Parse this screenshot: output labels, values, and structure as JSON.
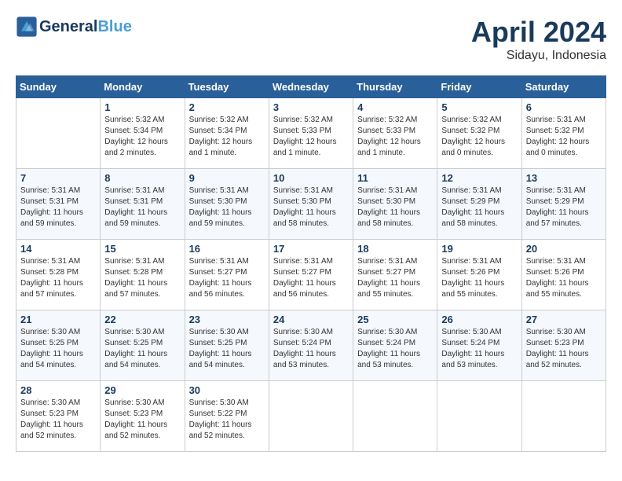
{
  "header": {
    "logo_line1": "General",
    "logo_line2": "Blue",
    "month": "April 2024",
    "location": "Sidayu, Indonesia"
  },
  "days_of_week": [
    "Sunday",
    "Monday",
    "Tuesday",
    "Wednesday",
    "Thursday",
    "Friday",
    "Saturday"
  ],
  "weeks": [
    [
      {
        "day": "",
        "info": ""
      },
      {
        "day": "1",
        "info": "Sunrise: 5:32 AM\nSunset: 5:34 PM\nDaylight: 12 hours\nand 2 minutes."
      },
      {
        "day": "2",
        "info": "Sunrise: 5:32 AM\nSunset: 5:34 PM\nDaylight: 12 hours\nand 1 minute."
      },
      {
        "day": "3",
        "info": "Sunrise: 5:32 AM\nSunset: 5:33 PM\nDaylight: 12 hours\nand 1 minute."
      },
      {
        "day": "4",
        "info": "Sunrise: 5:32 AM\nSunset: 5:33 PM\nDaylight: 12 hours\nand 1 minute."
      },
      {
        "day": "5",
        "info": "Sunrise: 5:32 AM\nSunset: 5:32 PM\nDaylight: 12 hours\nand 0 minutes."
      },
      {
        "day": "6",
        "info": "Sunrise: 5:31 AM\nSunset: 5:32 PM\nDaylight: 12 hours\nand 0 minutes."
      }
    ],
    [
      {
        "day": "7",
        "info": "Sunrise: 5:31 AM\nSunset: 5:31 PM\nDaylight: 11 hours\nand 59 minutes."
      },
      {
        "day": "8",
        "info": "Sunrise: 5:31 AM\nSunset: 5:31 PM\nDaylight: 11 hours\nand 59 minutes."
      },
      {
        "day": "9",
        "info": "Sunrise: 5:31 AM\nSunset: 5:30 PM\nDaylight: 11 hours\nand 59 minutes."
      },
      {
        "day": "10",
        "info": "Sunrise: 5:31 AM\nSunset: 5:30 PM\nDaylight: 11 hours\nand 58 minutes."
      },
      {
        "day": "11",
        "info": "Sunrise: 5:31 AM\nSunset: 5:30 PM\nDaylight: 11 hours\nand 58 minutes."
      },
      {
        "day": "12",
        "info": "Sunrise: 5:31 AM\nSunset: 5:29 PM\nDaylight: 11 hours\nand 58 minutes."
      },
      {
        "day": "13",
        "info": "Sunrise: 5:31 AM\nSunset: 5:29 PM\nDaylight: 11 hours\nand 57 minutes."
      }
    ],
    [
      {
        "day": "14",
        "info": "Sunrise: 5:31 AM\nSunset: 5:28 PM\nDaylight: 11 hours\nand 57 minutes."
      },
      {
        "day": "15",
        "info": "Sunrise: 5:31 AM\nSunset: 5:28 PM\nDaylight: 11 hours\nand 57 minutes."
      },
      {
        "day": "16",
        "info": "Sunrise: 5:31 AM\nSunset: 5:27 PM\nDaylight: 11 hours\nand 56 minutes."
      },
      {
        "day": "17",
        "info": "Sunrise: 5:31 AM\nSunset: 5:27 PM\nDaylight: 11 hours\nand 56 minutes."
      },
      {
        "day": "18",
        "info": "Sunrise: 5:31 AM\nSunset: 5:27 PM\nDaylight: 11 hours\nand 55 minutes."
      },
      {
        "day": "19",
        "info": "Sunrise: 5:31 AM\nSunset: 5:26 PM\nDaylight: 11 hours\nand 55 minutes."
      },
      {
        "day": "20",
        "info": "Sunrise: 5:31 AM\nSunset: 5:26 PM\nDaylight: 11 hours\nand 55 minutes."
      }
    ],
    [
      {
        "day": "21",
        "info": "Sunrise: 5:30 AM\nSunset: 5:25 PM\nDaylight: 11 hours\nand 54 minutes."
      },
      {
        "day": "22",
        "info": "Sunrise: 5:30 AM\nSunset: 5:25 PM\nDaylight: 11 hours\nand 54 minutes."
      },
      {
        "day": "23",
        "info": "Sunrise: 5:30 AM\nSunset: 5:25 PM\nDaylight: 11 hours\nand 54 minutes."
      },
      {
        "day": "24",
        "info": "Sunrise: 5:30 AM\nSunset: 5:24 PM\nDaylight: 11 hours\nand 53 minutes."
      },
      {
        "day": "25",
        "info": "Sunrise: 5:30 AM\nSunset: 5:24 PM\nDaylight: 11 hours\nand 53 minutes."
      },
      {
        "day": "26",
        "info": "Sunrise: 5:30 AM\nSunset: 5:24 PM\nDaylight: 11 hours\nand 53 minutes."
      },
      {
        "day": "27",
        "info": "Sunrise: 5:30 AM\nSunset: 5:23 PM\nDaylight: 11 hours\nand 52 minutes."
      }
    ],
    [
      {
        "day": "28",
        "info": "Sunrise: 5:30 AM\nSunset: 5:23 PM\nDaylight: 11 hours\nand 52 minutes."
      },
      {
        "day": "29",
        "info": "Sunrise: 5:30 AM\nSunset: 5:23 PM\nDaylight: 11 hours\nand 52 minutes."
      },
      {
        "day": "30",
        "info": "Sunrise: 5:30 AM\nSunset: 5:22 PM\nDaylight: 11 hours\nand 52 minutes."
      },
      {
        "day": "",
        "info": ""
      },
      {
        "day": "",
        "info": ""
      },
      {
        "day": "",
        "info": ""
      },
      {
        "day": "",
        "info": ""
      }
    ]
  ]
}
